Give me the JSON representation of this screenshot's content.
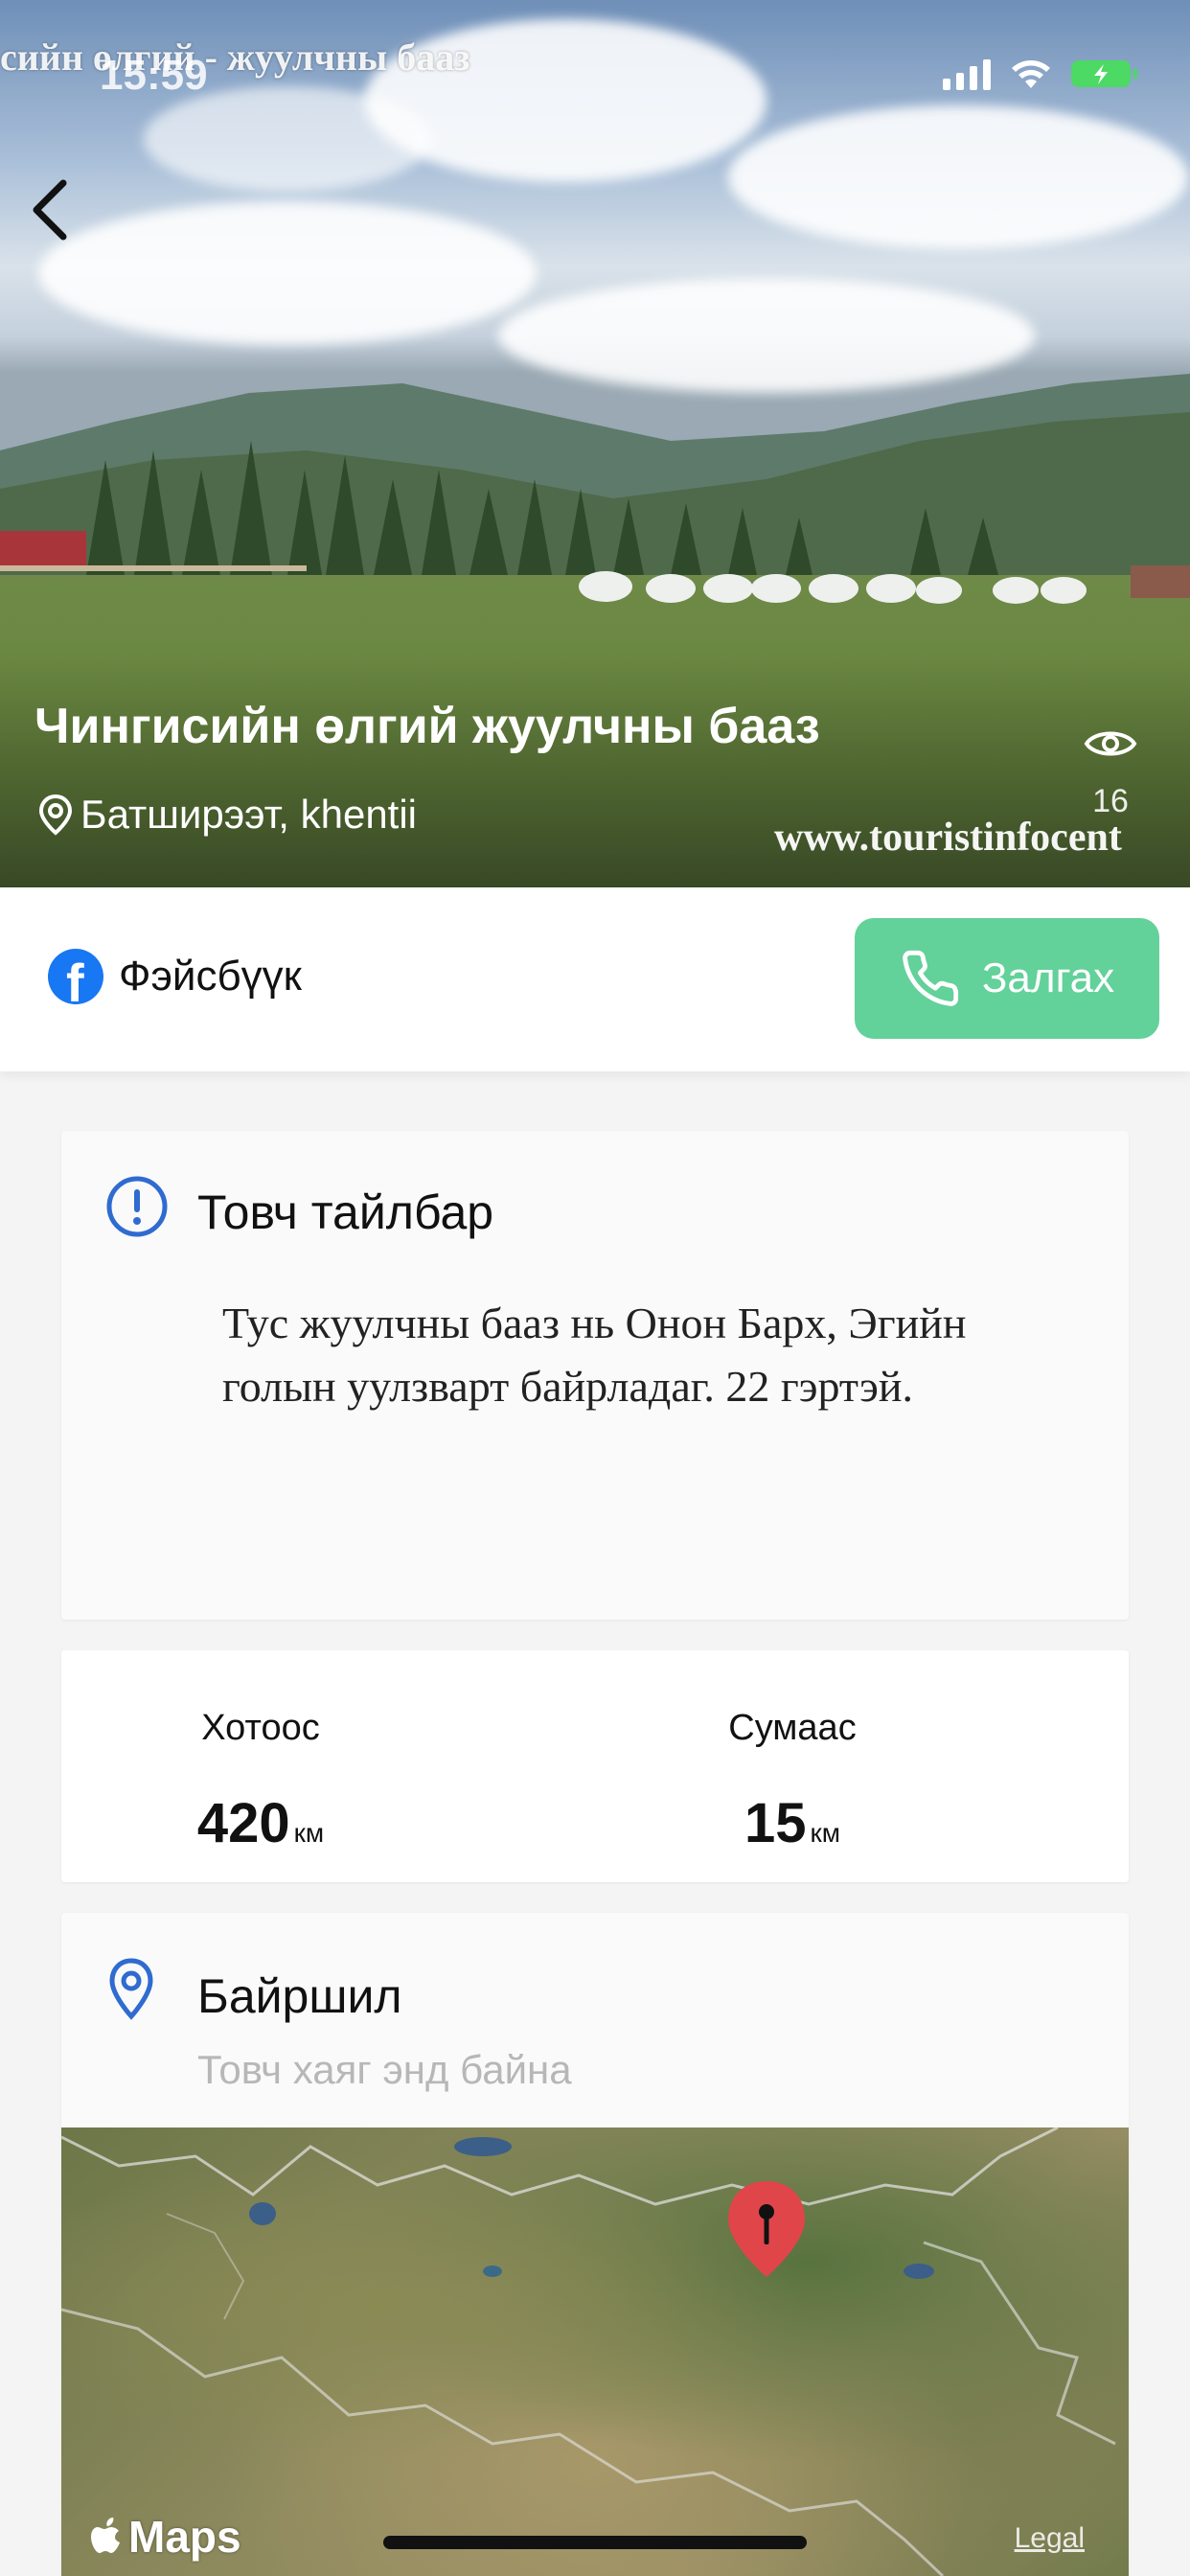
{
  "watermarks": {
    "top": "сийн өлгий - жуулчны бааз",
    "bottom": "www.touristinfocent"
  },
  "status_bar": {
    "time": "15:59",
    "icons": [
      "signal-icon",
      "wifi-icon",
      "battery-charging-icon"
    ],
    "battery_color": "#4cd964"
  },
  "hero": {
    "back_icon": "chevron-left-icon",
    "title": "Чингисийн өлгий жуулчны бааз",
    "location_icon": "location-pin-icon",
    "location": "Батширээт, khentii",
    "views_icon": "eye-icon",
    "views_count": "16"
  },
  "actions": {
    "facebook_icon": "facebook-icon",
    "facebook_label": "Фэйсбүүк",
    "call_icon": "phone-icon",
    "call_label": "Залгах",
    "call_color": "#63d19a"
  },
  "description": {
    "icon": "info-icon",
    "heading": "Товч тайлбар",
    "text": "Тус жуулчны бааз нь Онон Барх, Эгийн голын уулзварт байрладаг. 22 гэртэй."
  },
  "distances": {
    "from_city": {
      "label": "Хотоос",
      "value": "420",
      "unit": "км"
    },
    "from_soum": {
      "label": "Сумаас",
      "value": "15",
      "unit": "км"
    }
  },
  "location_section": {
    "icon": "location-pin-icon",
    "heading": "Байршил",
    "subtitle": "Товч хаяг энд байна",
    "accent_color": "#2f6bd0"
  },
  "map": {
    "pin_icon": "map-pin-icon",
    "pin_color": "#e0454a",
    "maps_logo_icon": "apple-icon",
    "maps_label": "Maps",
    "legal_label": "Legal"
  }
}
